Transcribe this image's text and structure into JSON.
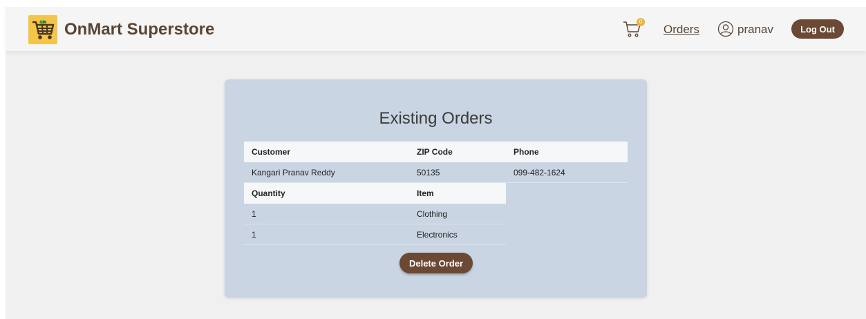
{
  "brand": {
    "name": "OnMart Superstore"
  },
  "nav": {
    "cart_count": "0",
    "orders_label": "Orders",
    "username": "pranav",
    "logout_label": "Log Out"
  },
  "card": {
    "title": "Existing Orders",
    "order_headers": [
      "Customer",
      "ZIP Code",
      "Phone"
    ],
    "order": {
      "customer": "Kangari Pranav Reddy",
      "zip": "50135",
      "phone": "099-482-1624"
    },
    "item_headers": [
      "Quantity",
      "Item"
    ],
    "items": [
      {
        "quantity": "1",
        "item": "Clothing"
      },
      {
        "quantity": "1",
        "item": "Electronics"
      }
    ],
    "delete_label": "Delete Order"
  },
  "colors": {
    "brand_brown": "#5a4433",
    "button_brown": "#6b4934",
    "logo_yellow": "#f3c54a",
    "card_blue": "#c9d5e2"
  }
}
